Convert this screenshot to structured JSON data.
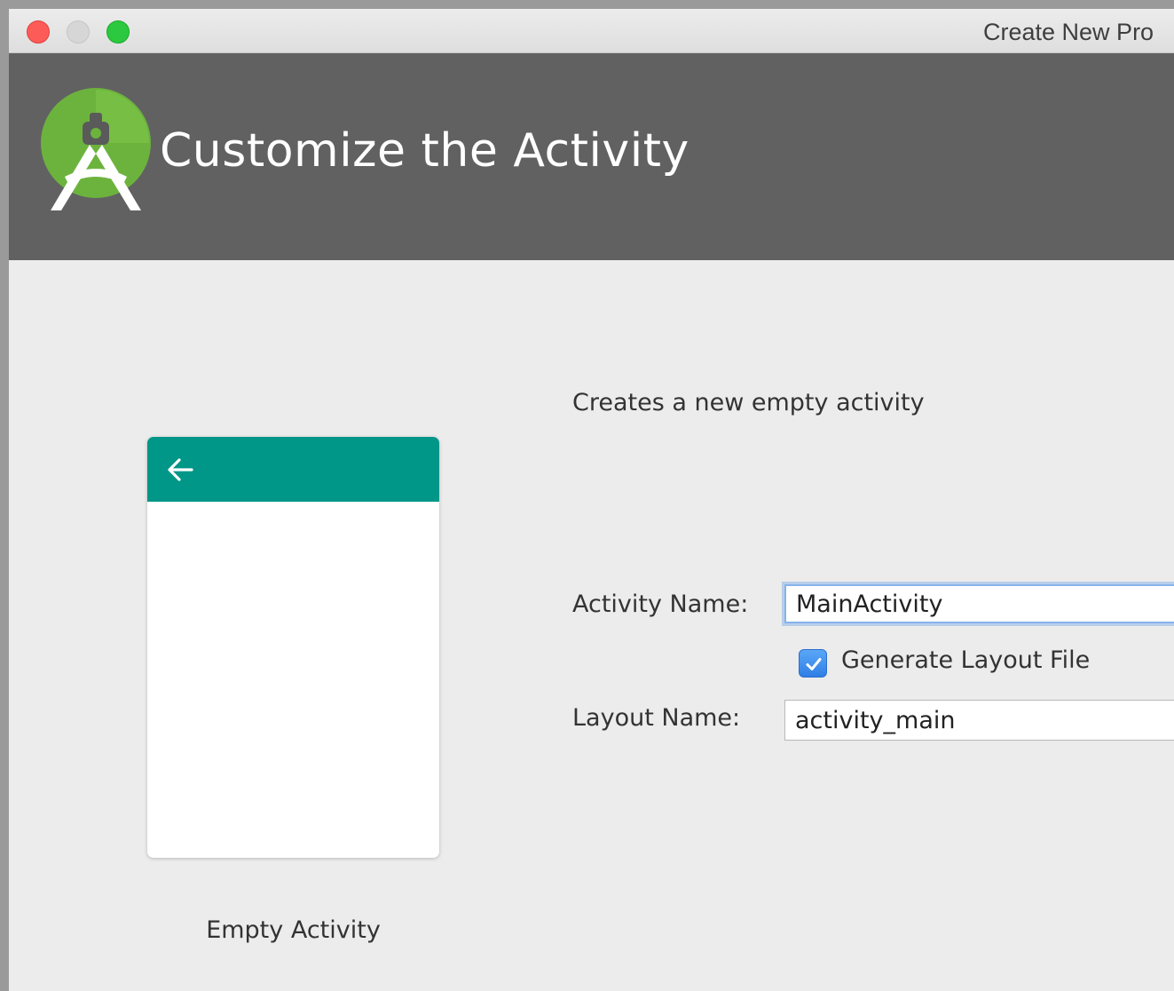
{
  "window": {
    "title": "Create New Pro"
  },
  "header": {
    "title": "Customize the Activity",
    "logo_icon": "android-studio-logo-icon"
  },
  "preview": {
    "label": "Empty Activity",
    "appbar_color": "#009688",
    "back_icon": "arrow-left-icon"
  },
  "form": {
    "description": "Creates a new empty activity",
    "activity_name": {
      "label": "Activity Name:",
      "value": "MainActivity"
    },
    "generate_layout": {
      "label": "Generate Layout File",
      "checked": true
    },
    "layout_name": {
      "label": "Layout Name:",
      "value": "activity_main"
    }
  },
  "colors": {
    "header_bg": "#616161",
    "checkbox_accent": "#3b8ef0",
    "close": "#fc5b57",
    "zoom": "#2bc840"
  }
}
